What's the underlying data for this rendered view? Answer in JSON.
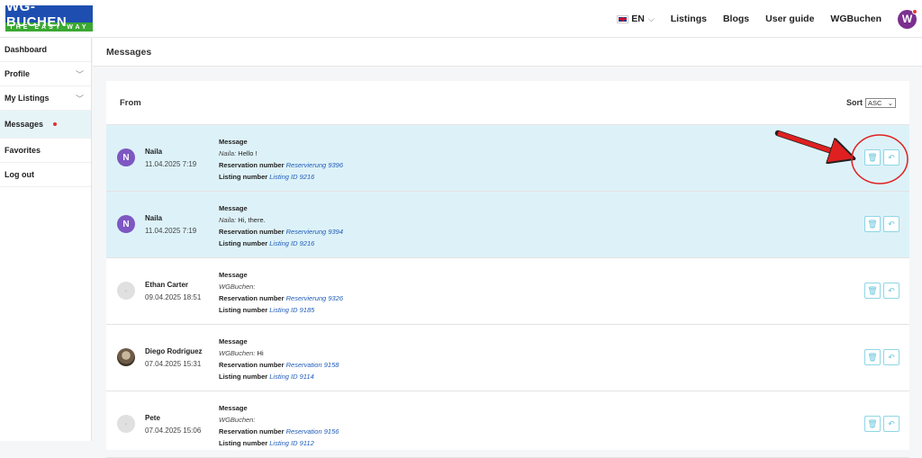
{
  "header": {
    "logo_top": "WG-BUCHEN",
    "logo_bottom": "THE EASY WAY",
    "language": "EN",
    "nav": [
      "Listings",
      "Blogs",
      "User guide",
      "WGBuchen"
    ],
    "avatar_initial": "W"
  },
  "sidebar": {
    "items": [
      {
        "label": "Dashboard"
      },
      {
        "label": "Profile"
      },
      {
        "label": "My Listings"
      },
      {
        "label": "Messages"
      },
      {
        "label": "Favorites"
      },
      {
        "label": "Log out"
      }
    ]
  },
  "page": {
    "title": "Messages",
    "from_label": "From",
    "sort_label": "Sort",
    "sort_value": "ASC"
  },
  "labels": {
    "message": "Message",
    "reservation": "Reservation number",
    "listing": "Listing number"
  },
  "messages": [
    {
      "initial": "N",
      "name": "Naila",
      "date": "11.04.2025 7:19",
      "author": "Naila:",
      "text": "Hello !",
      "reservation": "Reservierung 9396",
      "listing": "Listing ID 9216"
    },
    {
      "initial": "N",
      "name": "Naila",
      "date": "11.04.2025 7:19",
      "author": "Naila:",
      "text": "Hi, there.",
      "reservation": "Reservierung 9394",
      "listing": "Listing ID 9216"
    },
    {
      "initial": "",
      "name": "Ethan Carter",
      "date": "09.04.2025 18:51",
      "author": "WGBuchen:",
      "text": "",
      "reservation": "Reservierung 9326",
      "listing": "Listing ID 9185"
    },
    {
      "initial": "",
      "name": "Diego Rodriguez",
      "date": "07.04.2025 15:31",
      "author": "WGBuchen:",
      "text": "Hi",
      "reservation": "Reservation 9158",
      "listing": "Listing ID 9114"
    },
    {
      "initial": "",
      "name": "Pete",
      "date": "07.04.2025 15:06",
      "author": "WGBuchen:",
      "text": "",
      "reservation": "Reservation 9156",
      "listing": "Listing ID 9112"
    }
  ],
  "colors": {
    "brand_blue": "#1e4fb0",
    "brand_green": "#3aa832",
    "unread_bg": "#ddf2f8",
    "annotation_red": "#e02020"
  }
}
